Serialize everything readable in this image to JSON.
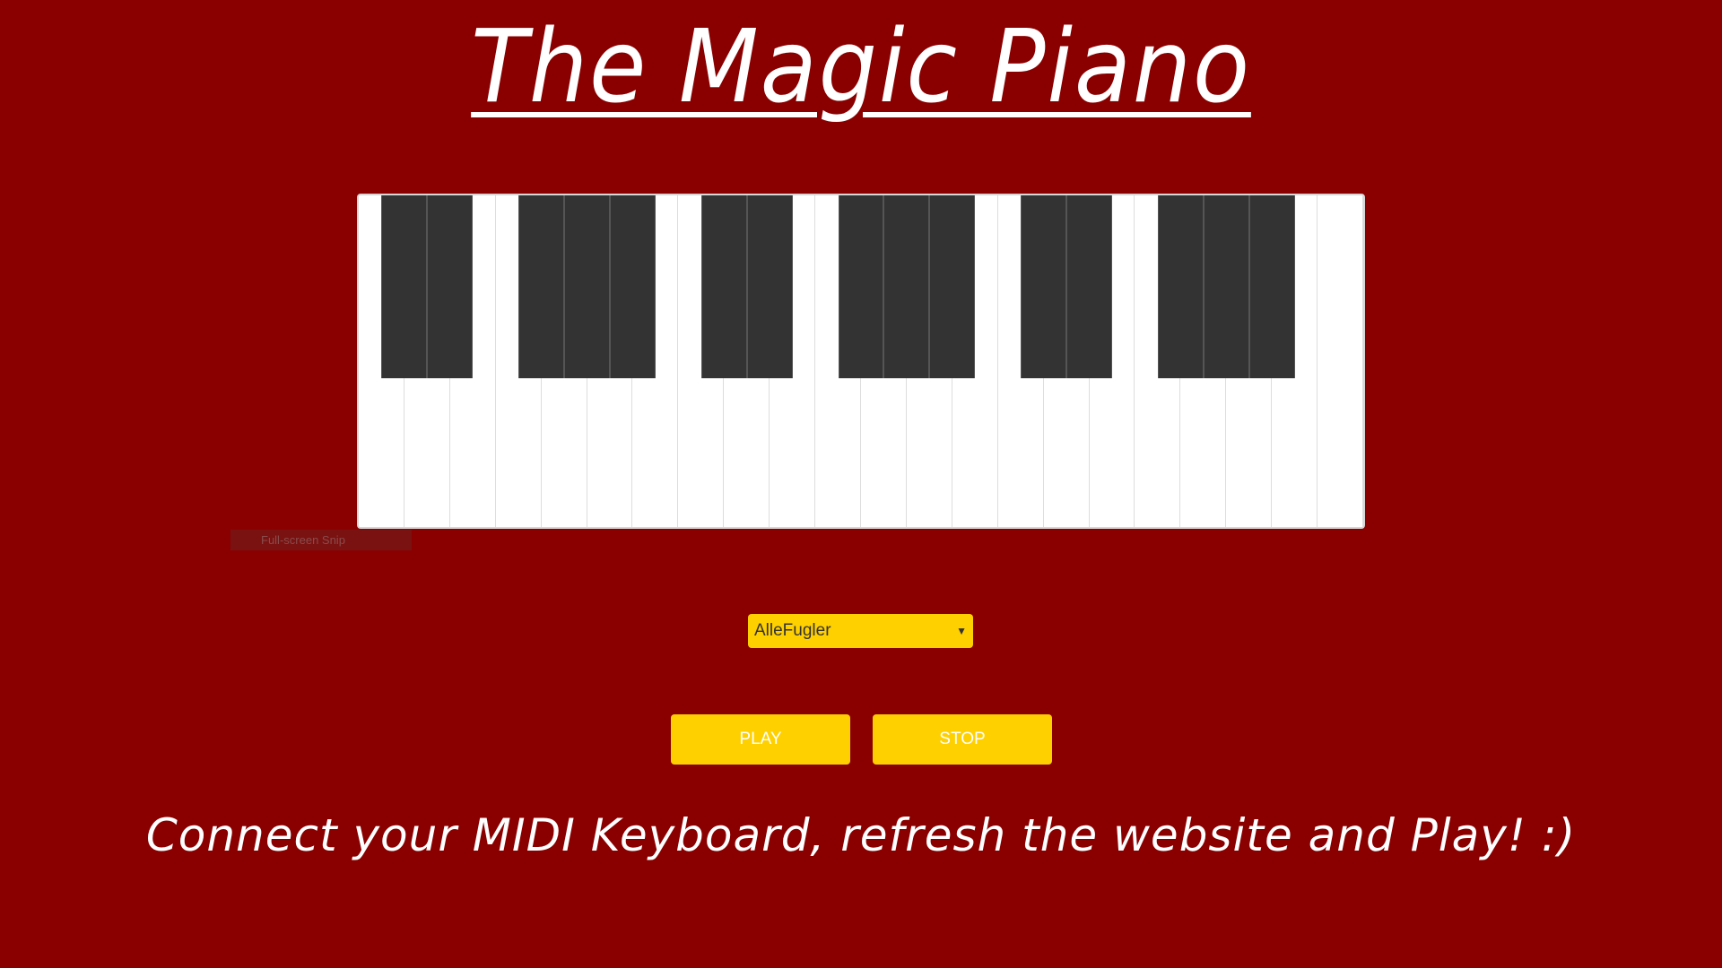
{
  "header": {
    "title": "The Magic Piano"
  },
  "piano": {
    "white_keys": 22,
    "black_key_groups": [
      2,
      3,
      2,
      3,
      2,
      3
    ]
  },
  "overlay": {
    "snip_label": "Full-screen Snip"
  },
  "controls": {
    "song_select_value": "AlleFugler",
    "play_label": "PLAY",
    "stop_label": "STOP"
  },
  "footer": {
    "instructions": "Connect your MIDI Keyboard, refresh the website and Play! :)"
  },
  "colors": {
    "background": "#8a0000",
    "accent": "#ffd000",
    "black_key": "#333333",
    "white_key": "#ffffff"
  }
}
